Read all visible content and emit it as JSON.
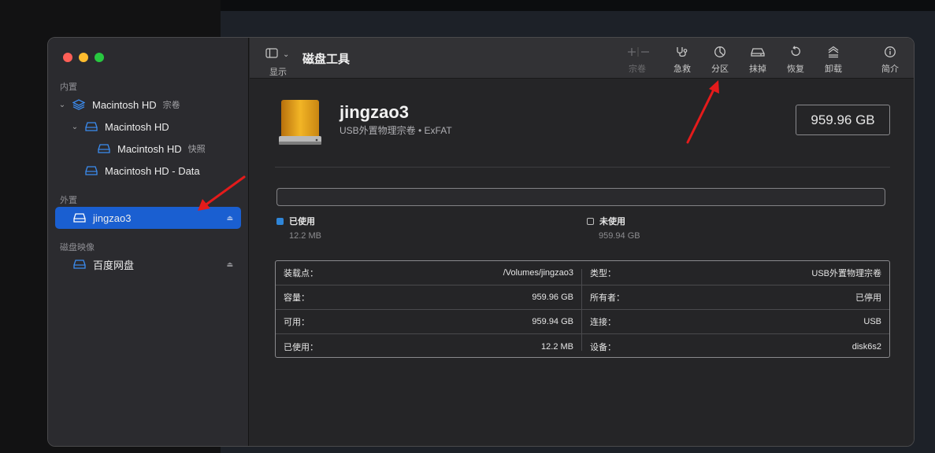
{
  "app": {
    "title": "磁盘工具",
    "view_label": "显示"
  },
  "sidebar": {
    "sections": [
      {
        "title": "内置"
      },
      {
        "title": "外置"
      },
      {
        "title": "磁盘映像"
      }
    ],
    "items": [
      {
        "label": "Macintosh HD",
        "sub": "宗卷"
      },
      {
        "label": "Macintosh HD"
      },
      {
        "label": "Macintosh HD",
        "sub": "快照"
      },
      {
        "label": "Macintosh HD - Data"
      },
      {
        "label": "jingzao3",
        "selected": true
      },
      {
        "label": "百度网盘"
      }
    ]
  },
  "toolbar": {
    "volume_label": "宗卷",
    "first_aid_label": "急救",
    "partition_label": "分区",
    "erase_label": "抹掉",
    "restore_label": "恢复",
    "unmount_label": "卸载",
    "info_label": "简介"
  },
  "disk": {
    "name": "jingzao3",
    "subtitle": "USB外置物理宗卷 • ExFAT",
    "capacity": "959.96 GB"
  },
  "usage": {
    "used_label": "已使用",
    "used_value": "12.2 MB",
    "free_label": "未使用",
    "free_value": "959.94 GB",
    "used_color": "#2f86d8"
  },
  "info": {
    "left": [
      {
        "key": "装载点：",
        "value": "/Volumes/jingzao3"
      },
      {
        "key": "容量：",
        "value": "959.96 GB"
      },
      {
        "key": "可用：",
        "value": "959.94 GB"
      },
      {
        "key": "已使用：",
        "value": "12.2 MB"
      }
    ],
    "right": [
      {
        "key": "类型：",
        "value": "USB外置物理宗卷"
      },
      {
        "key": "所有者：",
        "value": "已停用"
      },
      {
        "key": "连接：",
        "value": "USB"
      },
      {
        "key": "设备：",
        "value": "disk6s2"
      }
    ]
  }
}
